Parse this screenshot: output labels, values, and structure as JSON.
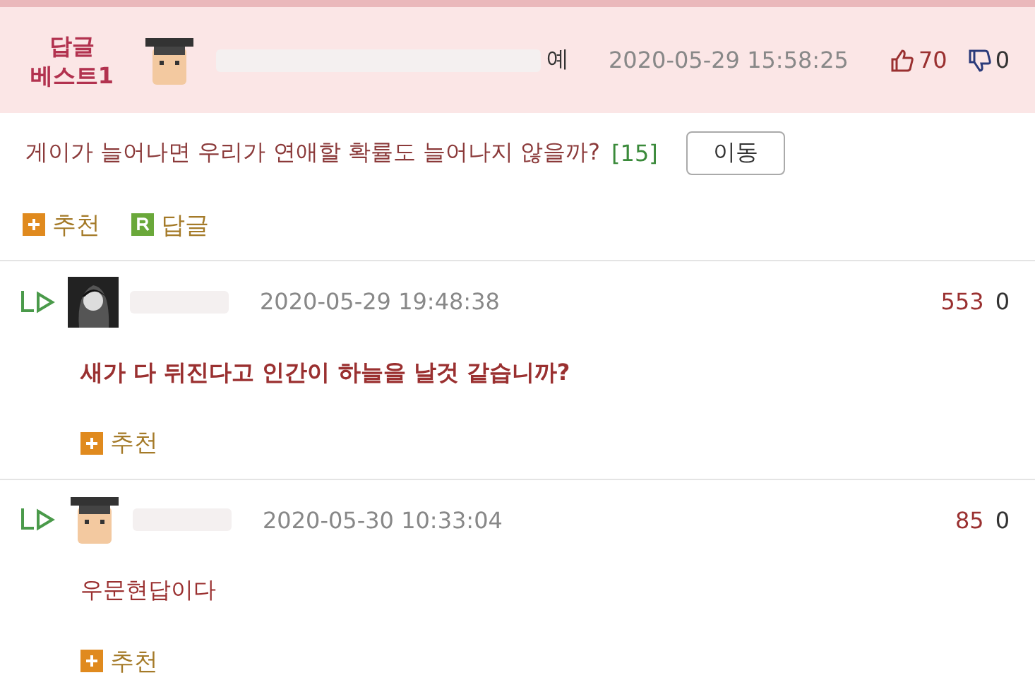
{
  "best_comment": {
    "badge_lines": [
      "답글",
      "베스트1"
    ],
    "author": {
      "avatar": {
        "kind": "cap"
      },
      "name_tail": "예"
    },
    "date": "2020-05-29 15:58:25",
    "likes": "70",
    "dislikes": "0",
    "title": "게이가 늘어나면 우리가 연애할 확률도 늘어나지 않을까?",
    "reply_count": "[15]",
    "move_button": "이동",
    "actions": [
      {
        "kind": "recommend",
        "label": "추천"
      },
      {
        "kind": "reply",
        "label": "답글"
      }
    ]
  },
  "replies": [
    {
      "author": {
        "avatar": {
          "kind": "dark"
        }
      },
      "date": "2020-05-29 19:48:38",
      "likes": "553",
      "dislikes": "0",
      "text": "새가 다 뒤진다고 인간이 하늘을 날것 같습니까?",
      "bold": true,
      "action": "추천"
    },
    {
      "author": {
        "avatar": {
          "kind": "cap"
        }
      },
      "date": "2020-05-30 10:33:04",
      "likes": "85",
      "dislikes": "0",
      "text": "우문현답이다",
      "bold": false,
      "action": "추천"
    }
  ]
}
